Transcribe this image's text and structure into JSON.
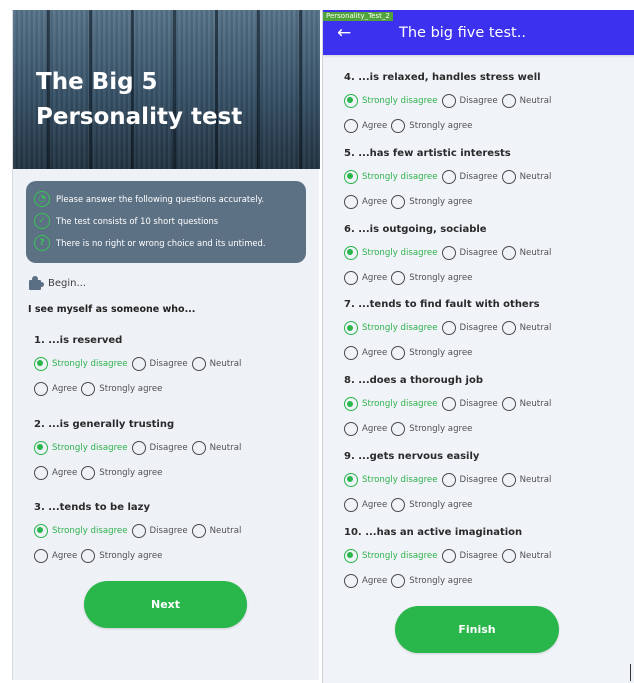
{
  "left_screen": {
    "hero_title": "The Big 5 Personality test",
    "info_items": [
      {
        "icon": "clock-icon",
        "glyph": "◔",
        "text": "Please answer the following questions accurately."
      },
      {
        "icon": "check-icon",
        "glyph": "✓",
        "text": "The test consists of 10 short questions"
      },
      {
        "icon": "question-icon",
        "glyph": "?",
        "text": "There is no right or wrong choice and its untimed."
      }
    ],
    "begin_label": "Begin...",
    "intro": "I see myself as someone who...",
    "questions": [
      {
        "title": "1. ...is reserved",
        "selected": "Strongly disagree"
      },
      {
        "title": "2. ...is generally trusting",
        "selected": "Strongly disagree"
      },
      {
        "title": "3. ...tends to be lazy",
        "selected": "Strongly disagree"
      }
    ],
    "next_label": "Next"
  },
  "right_screen": {
    "debug_tag": "Personality_Test_2",
    "back_icon": "back-arrow-icon",
    "title": "The big five test..",
    "questions": [
      {
        "title": "4. ...is relaxed, handles stress well",
        "selected": "Strongly disagree"
      },
      {
        "title": "5. ...has few artistic interests",
        "selected": "Strongly disagree"
      },
      {
        "title": "6. ...is outgoing, sociable",
        "selected": "Strongly disagree"
      },
      {
        "title": "7. ...tends to find fault with others",
        "selected": "Strongly disagree"
      },
      {
        "title": "8. ...does a thorough job",
        "selected": "Strongly disagree"
      },
      {
        "title": "9. ...gets nervous easily",
        "selected": "Strongly disagree"
      },
      {
        "title": "10. ...has an active imagination",
        "selected": "Strongly disagree"
      }
    ],
    "finish_label": "Finish"
  },
  "options": {
    "row1": [
      "Strongly disagree",
      "Disagree",
      "Neutral"
    ],
    "row2": [
      "Agree",
      "Strongly agree"
    ]
  },
  "colors": {
    "accent_green": "#29b64a",
    "appbar_blue": "#3b31ee",
    "info_card": "#5d7185",
    "background": "#eef1f6"
  }
}
